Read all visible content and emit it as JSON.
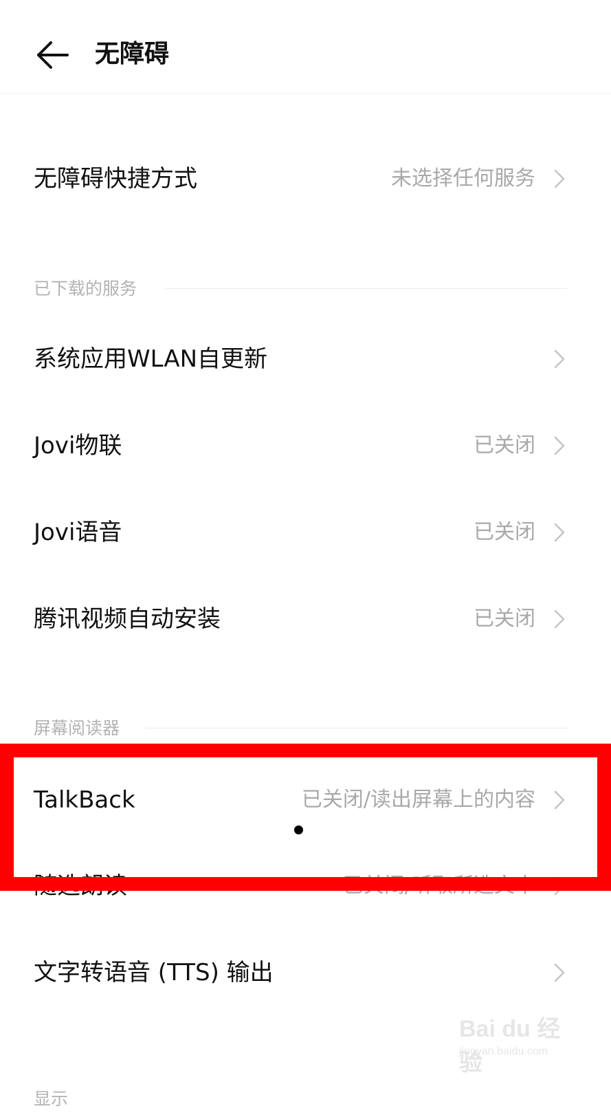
{
  "header": {
    "title": "无障碍",
    "back_icon": "back-arrow-icon"
  },
  "shortcut": {
    "label": "无障碍快捷方式",
    "value": "未选择任何服务"
  },
  "downloaded_section": {
    "title": "已下载的服务",
    "items": [
      {
        "label": "系统应用WLAN自更新",
        "value": ""
      },
      {
        "label": "Jovi物联",
        "value": "已关闭"
      },
      {
        "label": "Jovi语音",
        "value": "已关闭"
      },
      {
        "label": "腾讯视频自动安装",
        "value": "已关闭"
      }
    ]
  },
  "screen_reader_section": {
    "title": "屏幕阅读器",
    "items": [
      {
        "label": "TalkBack",
        "value": "已关闭/读出屏幕上的内容"
      },
      {
        "label": "随选朗读",
        "value": "已关闭/听取所选文本"
      },
      {
        "label": "文字转语音 (TTS) 输出",
        "value": ""
      }
    ]
  },
  "next_section": {
    "title": "显示"
  },
  "watermark": {
    "brand": "Bai du 经验",
    "url": "jingyan.baidu.com"
  },
  "colors": {
    "highlight": "#ff0000",
    "secondary_text": "#a9a9a9",
    "section_text": "#b3b3b3"
  }
}
